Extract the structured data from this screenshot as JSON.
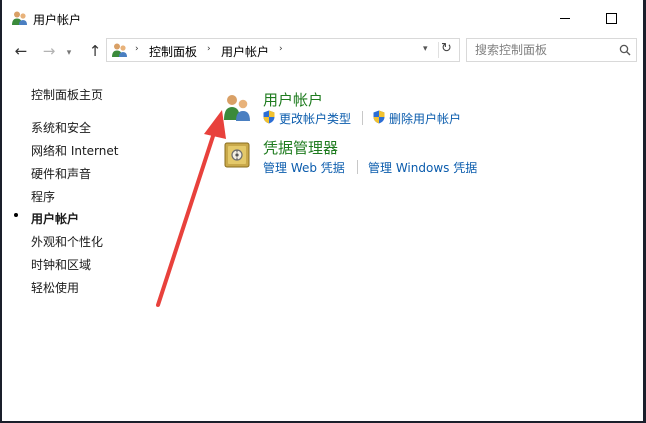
{
  "window": {
    "title": "用户帐户"
  },
  "titlebar": {
    "controls": [
      "minimize",
      "maximize"
    ]
  },
  "nav": {
    "back_icon": "←",
    "forward_icon": "→",
    "history_icon": "▾",
    "up_icon": "↑",
    "sep": "›",
    "breadcrumbs": [
      "控制面板",
      "用户帐户"
    ],
    "dropdown_icon": "▾",
    "refresh_icon": "↻",
    "search_placeholder": "搜索控制面板"
  },
  "sidebar": {
    "home": "控制面板主页",
    "items": [
      "系统和安全",
      "网络和 Internet",
      "硬件和声音",
      "程序",
      "用户帐户",
      "外观和个性化",
      "时钟和区域",
      "轻松使用"
    ],
    "current_item": "用户帐户"
  },
  "main": {
    "groups": [
      {
        "title": "用户帐户",
        "icon": "users-icon",
        "tasks": [
          "更改帐户类型",
          "删除用户帐户"
        ]
      },
      {
        "title": "凭据管理器",
        "icon": "credential-vault-icon",
        "tasks": [
          "管理 Web 凭据",
          "管理 Windows 凭据"
        ]
      }
    ]
  },
  "annotation": {
    "type": "red-arrow",
    "color": "#e8413c"
  },
  "colors": {
    "group_title": "#1e7b1e",
    "link": "#0b5cad",
    "shield_blue": "#2c6ed5",
    "shield_yellow": "#f2c230"
  }
}
